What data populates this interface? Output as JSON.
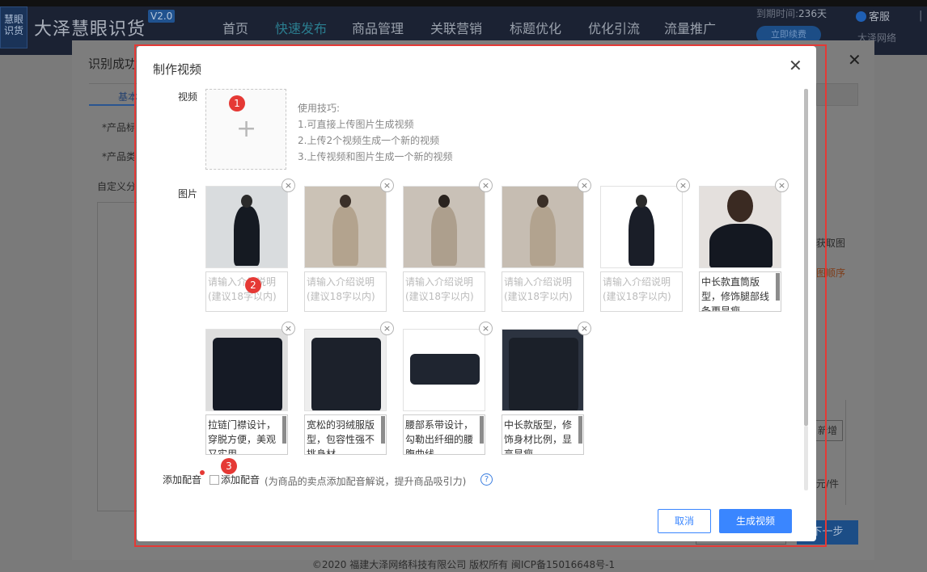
{
  "header": {
    "logo_text": "慧眼识货",
    "brand": "大泽慧眼识货",
    "version": "V2.0",
    "nav": [
      "首页",
      "快速发布",
      "商品管理",
      "关联营销",
      "标题优化",
      "优化引流",
      "流量推广"
    ],
    "active_nav": "快速发布",
    "expire_label": "到期时间:",
    "expire_value": "236天",
    "renew_label": "立即续费",
    "service_label": "客服",
    "company": "大泽网络",
    "separator": "|"
  },
  "footer": "©2020 福建大泽网络科技有限公司 版权所有 闽ICP备15016648号-1",
  "background_dialog": {
    "title": "识别成功",
    "tab": "基本",
    "labels": [
      "*产品标",
      "*产品类",
      "自定义分"
    ],
    "side_texts": [
      "获取图",
      "图顺序",
      "新增",
      "元/件"
    ],
    "next_button": "下一步"
  },
  "modal": {
    "title": "制作视频",
    "video_label": "视频",
    "image_label": "图片",
    "tips_title": "使用技巧:",
    "tips": [
      "1.可直接上传图片生成视频",
      "2.上传2个视频生成一个新的视频",
      "3.上传视频和图片生成一个新的视频"
    ],
    "placeholder": "请输入介绍说明(建议18字以内)",
    "images": [
      {
        "desc": ""
      },
      {
        "desc": ""
      },
      {
        "desc": ""
      },
      {
        "desc": ""
      },
      {
        "desc": ""
      },
      {
        "desc": "中长款直筒版型，修饰腿部线条更显瘦"
      },
      {
        "desc": "拉链门襟设计，穿脱方便，美观又实用"
      },
      {
        "desc": "宽松的羽绒服版型，包容性强不挑身材"
      },
      {
        "desc": "腰部系带设计，勾勒出纤细的腰腹曲线"
      },
      {
        "desc": "中长款版型，修饰身材比例，显高显瘦"
      }
    ],
    "dubbing_label": "添加配音",
    "dubbing_checkbox_label": "添加配音",
    "dubbing_hint": "(为商品的卖点添加配音解说，提升商品吸引力)",
    "help_glyph": "?",
    "cancel": "取消",
    "generate": "生成视频",
    "close_glyph": "✕",
    "remove_glyph": "×",
    "plus_glyph": "+",
    "badges": [
      "1",
      "2",
      "3"
    ]
  },
  "colors": {
    "primary": "#3a86ff",
    "highlight": "#e53935"
  }
}
